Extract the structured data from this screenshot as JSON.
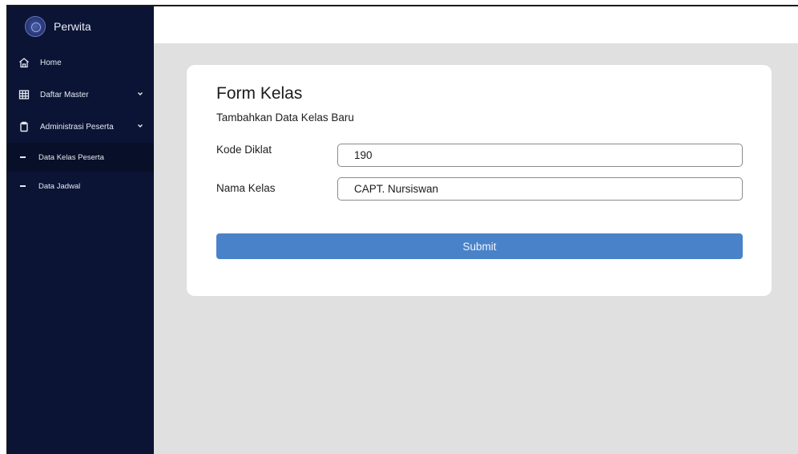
{
  "app": {
    "brand": "Perwita"
  },
  "sidebar": {
    "items": [
      {
        "label": "Home",
        "icon": "home-icon"
      },
      {
        "label": "Daftar Master",
        "icon": "grid-icon",
        "expandable": true
      },
      {
        "label": "Administrasi Peserta",
        "icon": "clipboard-icon",
        "expandable": true
      }
    ],
    "subitems": [
      {
        "label": "Data Kelas Peserta",
        "active": true
      },
      {
        "label": "Data Jadwal",
        "active": false
      }
    ]
  },
  "form": {
    "title": "Form Kelas",
    "subtitle": "Tambahkan Data Kelas Baru",
    "fields": [
      {
        "label": "Kode Diklat",
        "value": "190"
      },
      {
        "label": "Nama Kelas",
        "value": "CAPT. Nursiswan"
      }
    ],
    "submit_label": "Submit"
  },
  "colors": {
    "sidebar_bg": "#0b1434",
    "main_bg": "#e0e0e0",
    "button": "#4a82c9"
  }
}
